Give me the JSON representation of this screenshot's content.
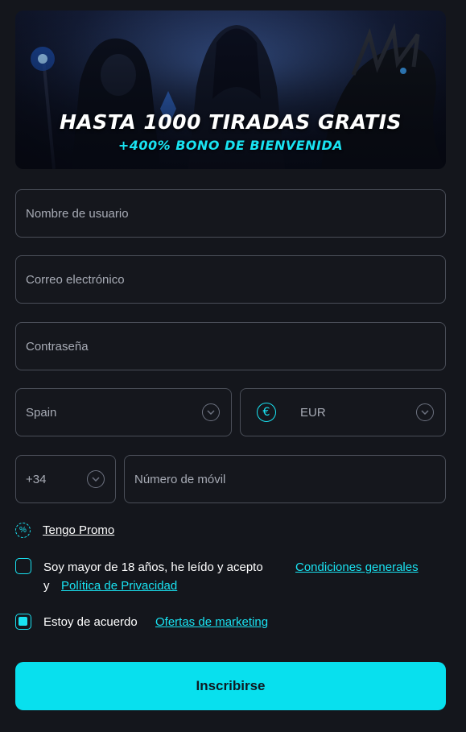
{
  "banner": {
    "title": "HASTA 1000 TIRADAS GRATIS",
    "subtitle": "+400% BONO DE BIENVENIDA"
  },
  "form": {
    "username_placeholder": "Nombre de usuario",
    "email_placeholder": "Correo electrónico",
    "password_placeholder": "Contraseña",
    "country_value": "Spain",
    "currency_symbol": "€",
    "currency_value": "EUR",
    "phone_code": "+34",
    "phone_placeholder": "Número de móvil",
    "promo_icon": "%",
    "promo_label": "Tengo Promo",
    "terms_text": "Soy mayor de 18 años, he leído y acepto",
    "terms_link": "Condiciones generales",
    "terms_and": "y",
    "privacy_link": "Política de Privacidad",
    "terms_checked": false,
    "marketing_text": "Estoy de acuerdo",
    "marketing_link": "Ofertas de marketing",
    "marketing_checked": true,
    "submit_label": "Inscribirse"
  },
  "colors": {
    "accent": "#19e3f2",
    "background": "#14161c",
    "button": "#08e0ee"
  }
}
